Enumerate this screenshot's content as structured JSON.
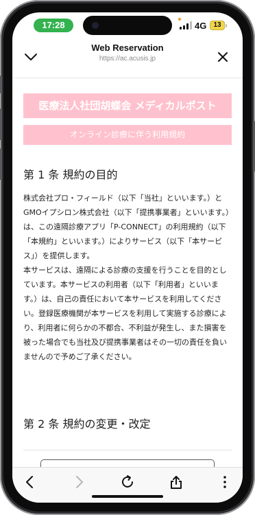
{
  "status_bar": {
    "time": "17:28",
    "network": "4G",
    "battery": "13"
  },
  "header": {
    "title": "Web Reservation",
    "url": "https://ac.acusis.jp",
    "back_icon": "chevron-down-icon",
    "close_icon": "close-icon"
  },
  "banners": {
    "clinic_name": "医療法人社団胡蝶会 メディカルポスト",
    "terms_title": "オンライン診療に伴う利用規約"
  },
  "article1": {
    "heading": "第 1 条 規約の目的",
    "body": "株式会社プロ・フィールド（以下「当社」といいます。）とGMOイプシロン株式会社（以下「提携事業者」といいます。）は、この遠隔診療アプリ「P-CONNECT」の利用規約（以下「本規約」といいます。）によりサービス（以下「本サービス」）を提供します。\n本サービスは、遠隔による診療の支援を行うことを目的としています。本サービスの利用者（以下「利用者」といいます。）は、自己の責任において本サービスを利用してください。登録医療機関が本サービスを利用して実施する診療により、利用者に何らかの不都合、不利益が発生し、また損害を被った場合でも当社及び提携事業者はその一切の責任を負いませんので予めご了承ください。"
  },
  "article2": {
    "heading": "第 2 条 規約の変更・改定"
  },
  "toolbar": {
    "icons": [
      "back-icon",
      "forward-icon",
      "reload-icon",
      "share-icon",
      "more-icon"
    ]
  },
  "colors": {
    "banner_bg": "#ffc1cd",
    "time_pill": "#33b24f",
    "battery": "#f1d64b"
  }
}
